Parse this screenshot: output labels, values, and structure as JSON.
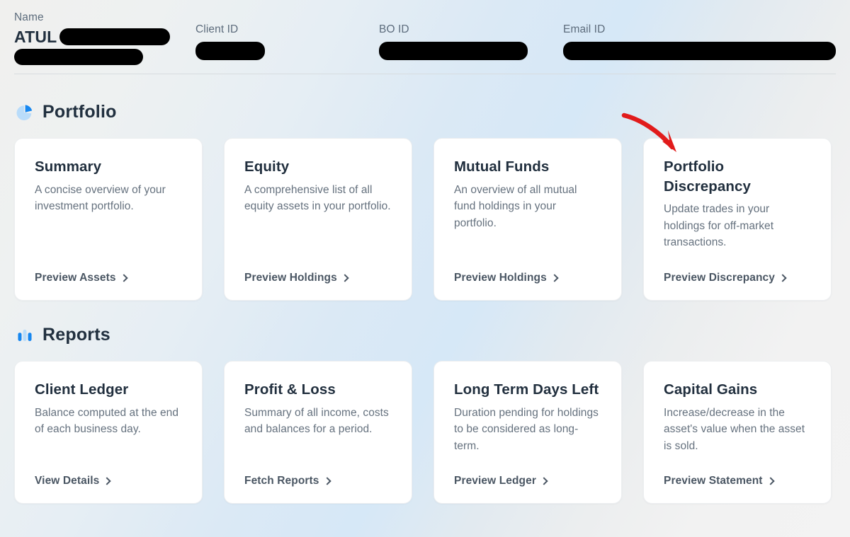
{
  "header": {
    "fields": [
      {
        "label": "Name",
        "value": "ATUL",
        "redacted": true
      },
      {
        "label": "Client ID",
        "value": "",
        "redacted": true
      },
      {
        "label": "BO ID",
        "value": "",
        "redacted": true
      },
      {
        "label": "Email ID",
        "value": "",
        "redacted": true
      }
    ]
  },
  "colors": {
    "accent_blue": "#1787f0",
    "accent_blue_light": "#b9dcfa",
    "heading": "#21303f",
    "body_text": "#65717e",
    "label": "#5d6c7c",
    "annotation_red": "#e11b1b",
    "card_bg": "#ffffff"
  },
  "sections": [
    {
      "id": "portfolio",
      "title": "Portfolio",
      "icon": "pie-chart-icon",
      "cards": [
        {
          "title": "Summary",
          "desc": "A concise overview of your investment portfolio.",
          "action": "Preview Assets"
        },
        {
          "title": "Equity",
          "desc": "A comprehensive list of all equity assets in your portfolio.",
          "action": "Preview Holdings"
        },
        {
          "title": "Mutual Funds",
          "desc": "An overview of all mutual fund holdings in your portfolio.",
          "action": "Preview Holdings"
        },
        {
          "title": "Portfolio Discrepancy",
          "desc": "Update trades in your holdings for off-market transactions.",
          "action": "Preview Discrepancy"
        }
      ]
    },
    {
      "id": "reports",
      "title": "Reports",
      "icon": "bar-chart-icon",
      "cards": [
        {
          "title": "Client Ledger",
          "desc": "Balance computed at the end of each business day.",
          "action": "View Details"
        },
        {
          "title": "Profit & Loss",
          "desc": "Summary of all income, costs and balances for a period.",
          "action": "Fetch Reports"
        },
        {
          "title": "Long Term Days Left",
          "desc": "Duration pending for holdings to be considered as long-term.",
          "action": "Preview Ledger"
        },
        {
          "title": "Capital Gains",
          "desc": "Increase/decrease in the asset's value when the asset is sold.",
          "action": "Preview Statement"
        }
      ]
    }
  ],
  "annotation": {
    "type": "curved-arrow",
    "points_to": "Portfolio Discrepancy",
    "color": "#e11b1b"
  }
}
